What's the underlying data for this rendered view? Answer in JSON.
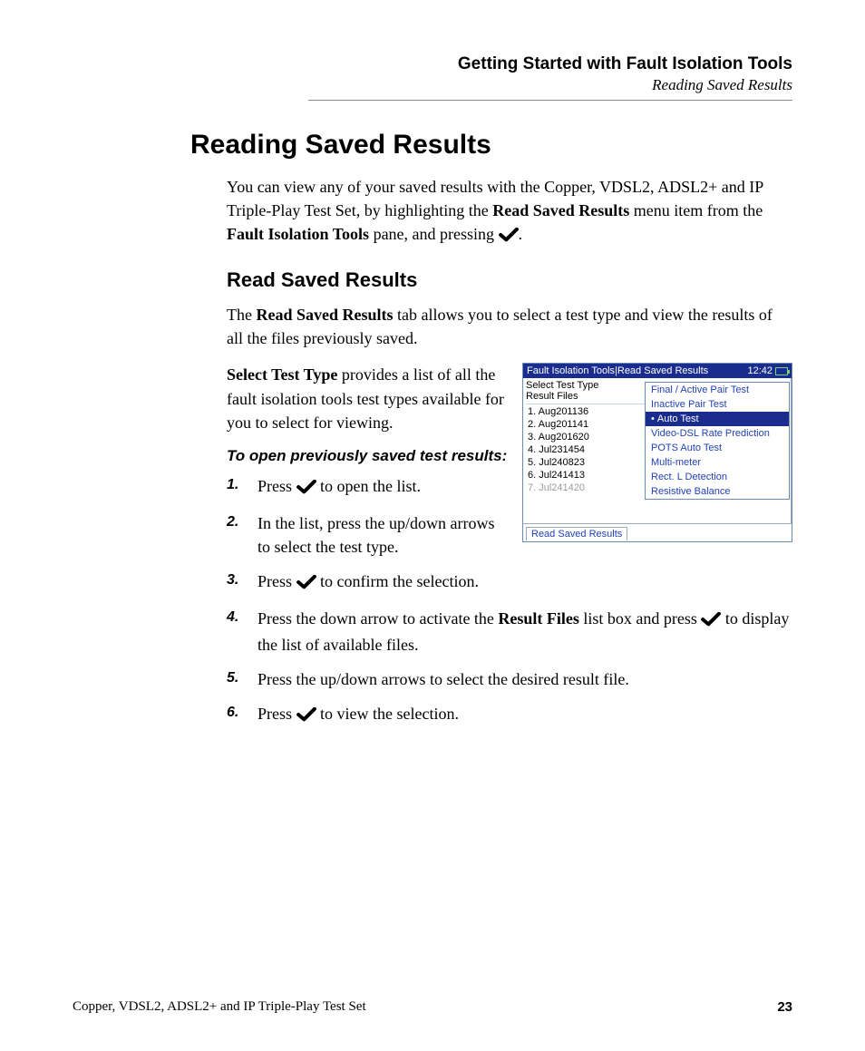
{
  "header": {
    "chapter": "Getting Started with Fault Isolation Tools",
    "section": "Reading Saved Results"
  },
  "title": "Reading Saved Results",
  "intro_parts": {
    "t1": "You can view any of your saved results with the Copper, VDSL2, ADSL2+ and IP Triple-Play Test Set, by highlighting the ",
    "b1": "Read Saved Results",
    "t2": " menu item from the ",
    "b2": "Fault Isolation Tools",
    "t3": " pane, and pressing ",
    "t4": "."
  },
  "sub_title": "Read Saved Results",
  "para1": {
    "t1": "The ",
    "b1": "Read Saved Results",
    "t2": " tab allows you to select a test type and view the results of all the files previously saved."
  },
  "para2": {
    "b1": "Select Test Type",
    "t1": " provides a list of all the fault isolation tools test types available for you to select for viewing."
  },
  "instr_head": "To open previously saved test results:",
  "steps": {
    "s1a": "Press ",
    "s1b": " to open the list.",
    "s2": "In the list, press the up/down arrows to select the test type.",
    "s3a": "Press ",
    "s3b": " to confirm the selection.",
    "s4a": "Press the down arrow to activate the ",
    "s4b": "Result Files",
    "s4c": " list box and press ",
    "s4d": " to display the list of available files.",
    "s5": "Press the up/down arrows to select the desired result file.",
    "s6a": "Press ",
    "s6b": " to view the selection."
  },
  "device": {
    "title": "Fault Isolation Tools|Read Saved Results",
    "clock": "12:42",
    "select_label": "Select Test Type",
    "files_label": "Result Files",
    "files": [
      "1. Aug201136",
      "2. Aug201141",
      "3. Aug201620",
      "4. Jul231454",
      "5. Jul240823",
      "6. Jul241413",
      "7. Jul241420"
    ],
    "options": [
      "Final / Active Pair Test",
      "Inactive Pair Test",
      "Auto Test",
      "Video-DSL Rate Prediction",
      "POTS Auto Test",
      "Multi-meter",
      "Rect. L Detection",
      "Resistive Balance"
    ],
    "selected_index": 2,
    "tab": "Read Saved Results"
  },
  "footer": {
    "left": "Copper, VDSL2, ADSL2+ and IP Triple-Play Test Set",
    "page": "23"
  }
}
